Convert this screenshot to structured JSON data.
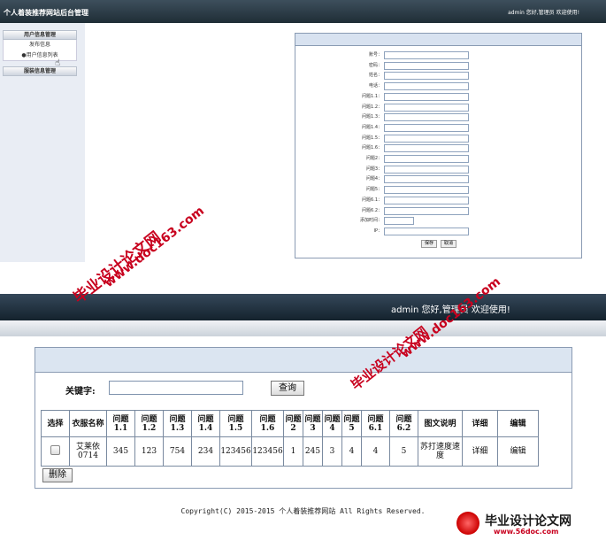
{
  "top": {
    "header_title": "个人着装推荐网站后台管理",
    "header_user": "admin 您好,管理员 欢迎使用!",
    "sidebar": [
      {
        "label": "用户信息管理",
        "type": "head"
      },
      {
        "label": "发布信息",
        "type": "item"
      },
      {
        "label": "用户信息列表",
        "type": "item"
      },
      {
        "label": "服装信息管理",
        "type": "head"
      }
    ],
    "form_fields": [
      "账号：",
      "密码：",
      "姓名：",
      "电话：",
      "问题1.1：",
      "问题1.2：",
      "问题1.3：",
      "问题1.4：",
      "问题1.5：",
      "问题1.6：",
      "问题2：",
      "问题3：",
      "问题4：",
      "问题5：",
      "问题6.1：",
      "问题6.2：",
      "添加时间：",
      "IP："
    ],
    "save_label": "保存",
    "cancel_label": "取消"
  },
  "bottom": {
    "header_user": "admin 您好,管理员 欢迎使用!",
    "keyword_label": "关键字:",
    "keyword_value": "",
    "search_label": "查询",
    "columns": [
      "选择",
      "衣服名称",
      "问题1.1",
      "问题1.2",
      "问题1.3",
      "问题1.4",
      "问题1.5",
      "问题1.6",
      "问题2",
      "问题3",
      "问题4",
      "问题5",
      "问题6.1",
      "问题6.2",
      "图文说明",
      "详细",
      "编辑"
    ],
    "rows": [
      {
        "name": "艾莱依0714",
        "q11": "345",
        "q12": "123",
        "q13": "754",
        "q14": "234",
        "q15": "123456",
        "q16": "123456",
        "q2": "1",
        "q3": "245",
        "q4": "3",
        "q5": "4",
        "q61": "4",
        "q62": "5",
        "desc": "苏打速度速度",
        "detail": "详细",
        "edit": "编辑"
      }
    ],
    "delete_label": "删除",
    "copyright": "Copyright(C) 2015-2015 个人着装推荐网站 All Rights Reserved."
  },
  "watermarks": {
    "cn": "毕业设计论文网",
    "url": "www.doc163.com",
    "logo_cn": "毕业设计论文网",
    "logo_url": "www.56doc.com"
  }
}
